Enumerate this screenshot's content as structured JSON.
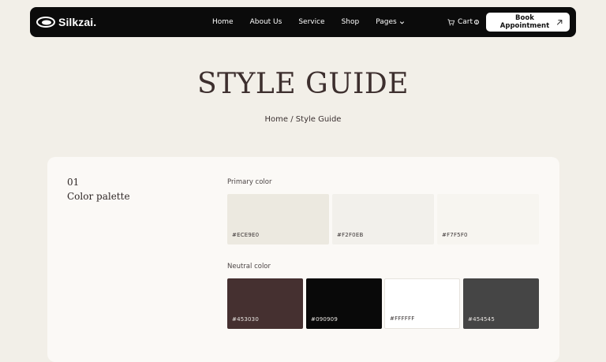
{
  "nav": {
    "brand": "Silkzai.",
    "links": [
      "Home",
      "About Us",
      "Service",
      "Shop",
      "Pages"
    ],
    "cart_label": "Cart",
    "cart_count": "0",
    "cta": "Book Appointment"
  },
  "hero": {
    "title": "STYLE GUIDE",
    "breadcrumb_home": "Home",
    "breadcrumb_sep": " / ",
    "breadcrumb_current": "Style Guide"
  },
  "section": {
    "number": "01",
    "title": "Color palette",
    "primary_label": "Primary color",
    "neutral_label": "Neutral color",
    "primary": [
      {
        "code": "#ECE9E0",
        "color": "#ECE9E0"
      },
      {
        "code": "#F2F0EB",
        "color": "#F2F0EB"
      },
      {
        "code": "#F7F5F0",
        "color": "#F7F5F0"
      }
    ],
    "neutral": [
      {
        "code": "#453030",
        "color": "#453030"
      },
      {
        "code": "#090909",
        "color": "#090909"
      },
      {
        "code": "#FFFFFF",
        "color": "#FFFFFF"
      },
      {
        "code": "#454545",
        "color": "#454545"
      }
    ]
  },
  "colors": {
    "page_bg": "#F2EFE8",
    "nav_bg": "#0B0B0B",
    "card_bg": "#FBF9F6",
    "title": "#3D2F2E"
  }
}
